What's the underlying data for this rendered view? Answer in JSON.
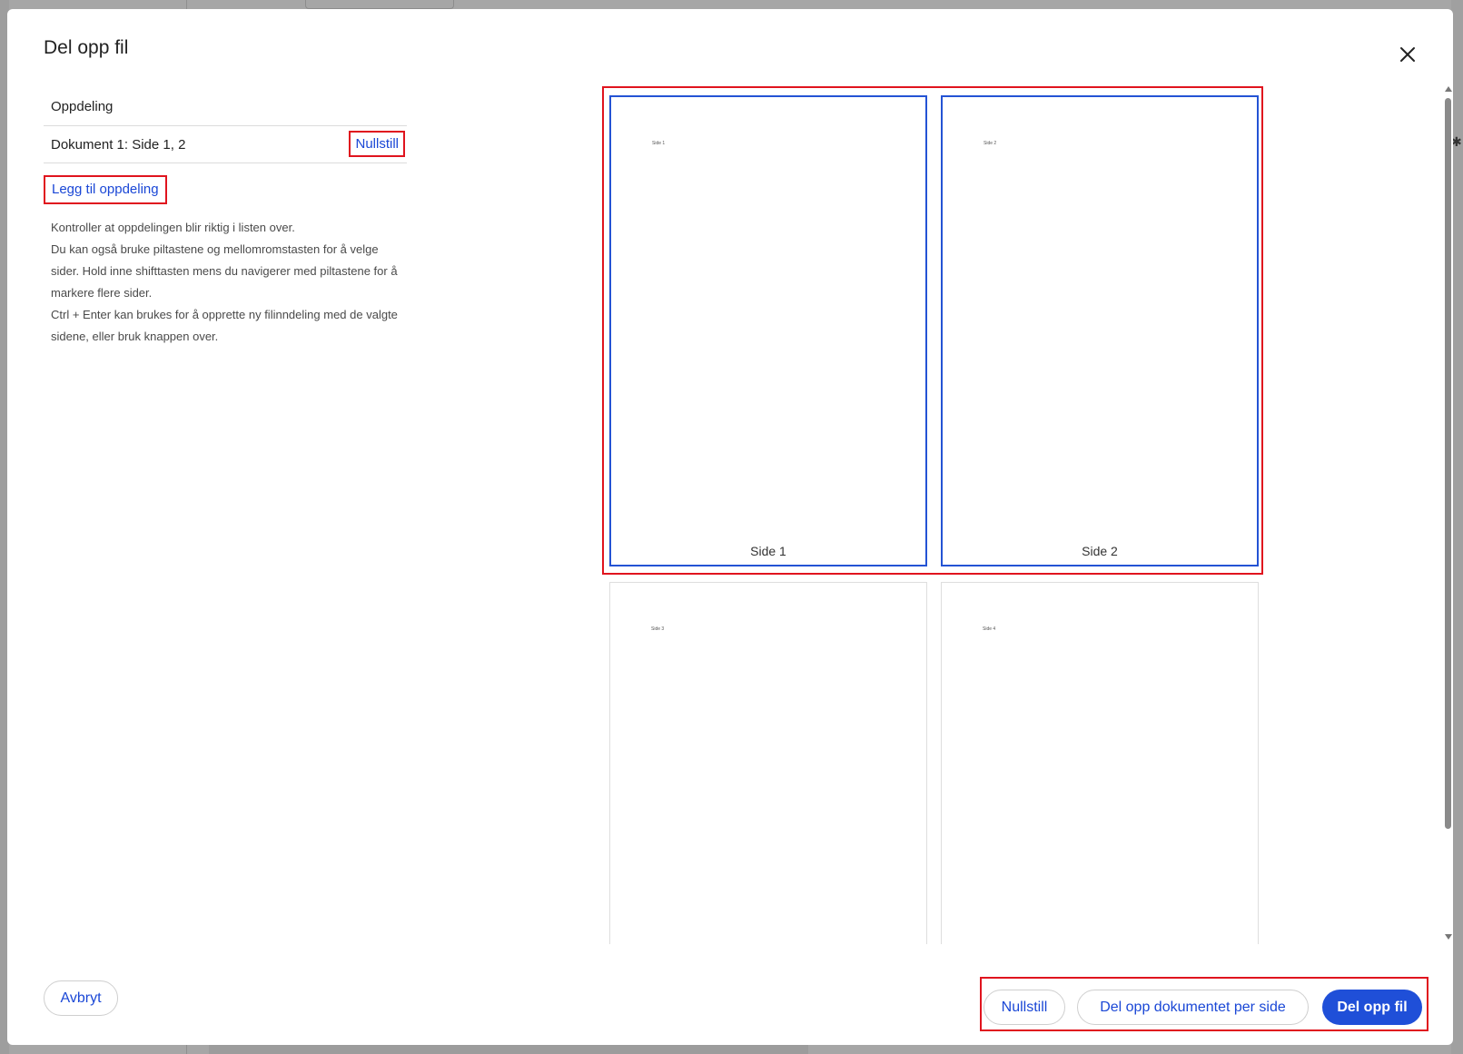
{
  "dialog": {
    "title": "Del opp fil",
    "close_icon": "close-icon"
  },
  "left_panel": {
    "heading": "Oppdeling",
    "splits": [
      {
        "label": "Dokument 1: Side 1, 2",
        "reset_label": "Nullstill"
      }
    ],
    "add_split_label": "Legg til oppdeling",
    "help_lines": [
      "Kontroller at oppdelingen blir riktig i listen over.",
      "Du kan også bruke piltastene og mellomromstasten for å velge sider. Hold inne shifttasten mens du navigerer med piltastene for å markere flere sider.",
      "Ctrl + Enter kan brukes for å opprette ny filinndeling med de valgte sidene, eller bruk knappen over."
    ]
  },
  "pages": [
    {
      "mini_label": "Side 1",
      "caption": "Side 1",
      "selected": true
    },
    {
      "mini_label": "Side 2",
      "caption": "Side 2",
      "selected": true
    },
    {
      "mini_label": "Side 3",
      "caption": "",
      "selected": false
    },
    {
      "mini_label": "Side 4",
      "caption": "",
      "selected": false
    }
  ],
  "footer": {
    "cancel_label": "Avbryt",
    "reset_label": "Nullstill",
    "split_per_page_label": "Del opp dokumentet per side",
    "split_label": "Del opp fil"
  },
  "colors": {
    "accent": "#1f4fd8",
    "link": "#1a47d6",
    "highlight_frame": "#e0141e",
    "selected_page_border": "#2453d4"
  }
}
